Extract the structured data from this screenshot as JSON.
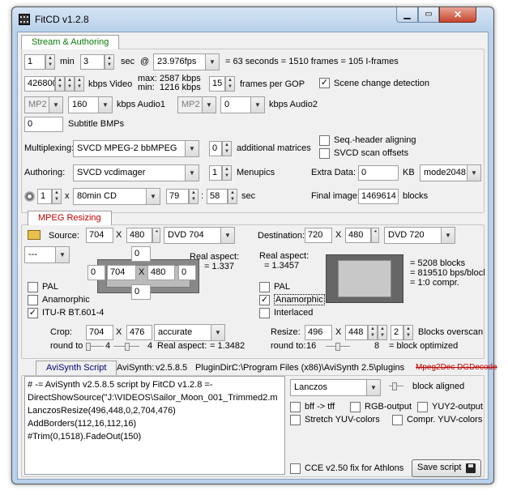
{
  "window": {
    "title": "FitCD v1.2.8"
  },
  "stream": {
    "tab": "Stream & Authoring",
    "hours": "1",
    "min_label": "min",
    "minutes": "3",
    "sec_label": "sec",
    "at": "@",
    "fps": "23.976fps",
    "summary": "= 63 seconds = 1510 frames = 105 I-frames",
    "video_kbps": "426800",
    "kbps_video_label": "kbps Video",
    "max_label": "max:",
    "max_val": "2587 kbps",
    "min_label2": "min:",
    "min_val": "1216 kbps",
    "gop": "15",
    "gop_label": "frames per GOP",
    "scene_change": "Scene change detection",
    "audio1_codec": "MP2",
    "audio1_kbps": "160",
    "audio1_label": "kbps Audio1",
    "audio2_codec": "MP2",
    "audio2_kbps": "0",
    "audio2_label": "kbps Audio2",
    "subtitle_count": "0",
    "subtitle_label": "Subtitle BMPs",
    "mux_label": "Multiplexing:",
    "mux_value": "SVCD MPEG-2 bbMPEG",
    "matrices": "0",
    "matrices_label": "additional matrices",
    "seq_header": "Seq.-header aligning",
    "svcd_scan": "SVCD scan offsets",
    "auth_label": "Authoring:",
    "auth_value": "SVCD vcdimager",
    "menupics": "1",
    "menupics_label": "Menupics",
    "extra_label": "Extra Data:",
    "extra_value": "0",
    "kb_label": "KB",
    "mode": "mode2048",
    "disc_count": "1",
    "x": "x",
    "disc_type": "80min CD",
    "disc_min": "79",
    "colon": ":",
    "disc_sec": "58",
    "sec2": "sec",
    "final_label": "Final image:",
    "final_value": "1469614",
    "blocks_label": "blocks"
  },
  "resize": {
    "tab": "MPEG Resizing",
    "source_label": "Source:",
    "src_w": "704",
    "x": "X",
    "src_h": "480",
    "src_std": "DVD 704",
    "dest_label": "Destination:",
    "dst_w": "720",
    "dst_h": "480",
    "dst_std": "DVD 720",
    "src_preset": "---",
    "crop_top": "0",
    "crop_left": "0",
    "crop_mid_w": "704",
    "crop_mid_h": "480",
    "crop_right": "0",
    "crop_bottom": "0",
    "real_aspect_label": "Real aspect:",
    "src_aspect": "= 1.337",
    "dst_aspect": "= 1.3457",
    "stats": [
      "= 5208 blocks",
      "= 819510 bps/block",
      "= 1:0 compr."
    ],
    "pal": "PAL",
    "anamorphic": "Anamorphic",
    "itur": "ITU-R BT.601-4",
    "dst_pal": "PAL",
    "dst_anamorphic": "Anamorphic",
    "interlaced": "Interlaced",
    "crop_label": "Crop:",
    "crop_w": "704",
    "crop_h": "476",
    "crop_mode": "accurate",
    "round_label": "round to",
    "round_src": "4",
    "real_aspect2_label": "Real aspect:",
    "real_aspect2": "= 1.3482",
    "resize_label": "Resize:",
    "resize_w": "496",
    "resize_h": "448",
    "overscan": "2",
    "overscan_label": "Blocks overscan",
    "round2_label": "round to:",
    "round_dst": "16",
    "round_dst2": "8",
    "block_opt": "= block optimized"
  },
  "avisynth": {
    "tab": "AviSynth Script",
    "version_label": "AviSynth:",
    "version": "v2.5.8.5",
    "plugin_label": "PluginDir:",
    "plugin_dir": "C:\\Program Files (x86)\\AviSynth 2.5\\plugins",
    "decoders": "Mpeg2Dec DGDecode",
    "script": [
      "# -= AviSynth v2.5.8.5 script by FitCD v1.2.8 =-",
      "DirectShowSource(\"J:\\VIDEOS\\Sailor_Moon_001_Trimmed2.m",
      "LanczosResize(496,448,0,2,704,476)",
      "AddBorders(112,16,112,16)",
      "#Trim(0,1518).FadeOut(150)"
    ],
    "resizer": "Lanczos",
    "block_aligned": "block aligned",
    "bff": "bff -> tff",
    "rgb": "RGB-output",
    "yuy2": "YUY2-output",
    "stretch": "Stretch YUV-colors",
    "compr": "Compr. YUV-colors",
    "cce": "CCE v2.50 fix for Athlons",
    "save": "Save script"
  }
}
